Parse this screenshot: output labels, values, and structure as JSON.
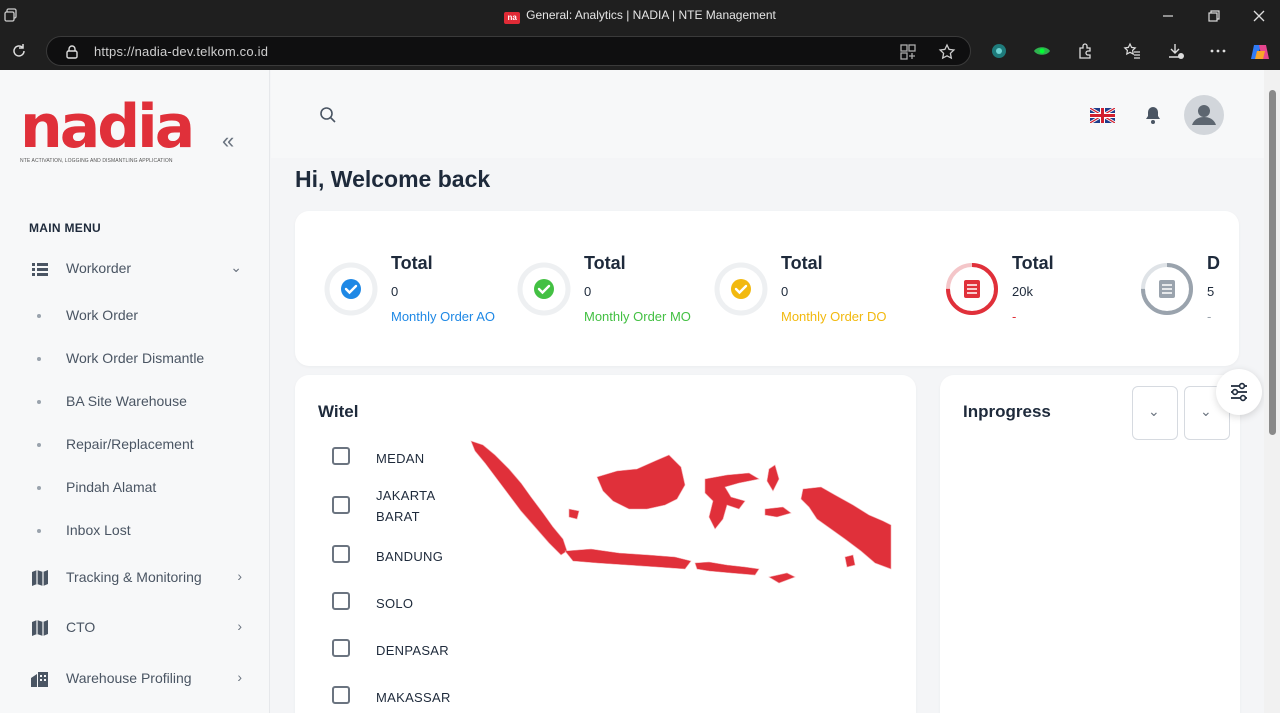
{
  "browser": {
    "tab_title": "General: Analytics | NADIA | NTE Management",
    "favicon_text": "na",
    "url": "https://nadia-dev.telkom.co.id"
  },
  "sidebar": {
    "logo_text": "nadia",
    "logo_subtitle": "NTE ACTIVATION, LOGGING AND DISMANTLING APPLICATION",
    "collapse_icon": "double-chevron-left-icon",
    "menu_heading": "MAIN MENU",
    "items": [
      {
        "label": "Workorder",
        "icon": "list-icon",
        "expanded": true,
        "children": [
          "Work Order",
          "Work Order Dismantle",
          "BA Site Warehouse",
          "Repair/Replacement",
          "Pindah Alamat",
          "Inbox Lost"
        ]
      },
      {
        "label": "Tracking & Monitoring",
        "icon": "map-icon"
      },
      {
        "label": "CTO",
        "icon": "map-icon"
      },
      {
        "label": "Warehouse Profiling",
        "icon": "building-icon"
      }
    ]
  },
  "header": {
    "search_icon": "search-icon",
    "language_icon": "uk-flag-icon",
    "notification_icon": "bell-icon",
    "avatar_icon": "user-avatar-icon"
  },
  "welcome": "Hi, Welcome back",
  "stats": [
    {
      "title": "Total",
      "value": "0",
      "subtitle": "Monthly Order AO",
      "color": "#1e88e5",
      "icon": "check-circle-icon"
    },
    {
      "title": "Total",
      "value": "0",
      "subtitle": "Monthly Order MO",
      "color": "#43c043",
      "icon": "check-circle-icon"
    },
    {
      "title": "Total",
      "value": "0",
      "subtitle": "Monthly Order DO",
      "color": "#f2b90f",
      "icon": "check-circle-icon"
    },
    {
      "title": "Total",
      "value": "20k",
      "subtitle": "-",
      "color": "#e0303a",
      "icon": "document-icon",
      "progress": 0.75
    },
    {
      "title": "D",
      "value": "5",
      "subtitle": "-",
      "color": "#9aa3ad",
      "icon": "document-icon",
      "progress": 0.75
    }
  ],
  "witel": {
    "title": "Witel",
    "options": [
      "MEDAN",
      "JAKARTA BARAT",
      "BANDUNG",
      "SOLO",
      "DENPASAR",
      "MAKASSAR"
    ]
  },
  "inprogress": {
    "title": "Inprogress"
  },
  "colors": {
    "brand": "#e0303a",
    "map_fill": "#e0303a"
  }
}
